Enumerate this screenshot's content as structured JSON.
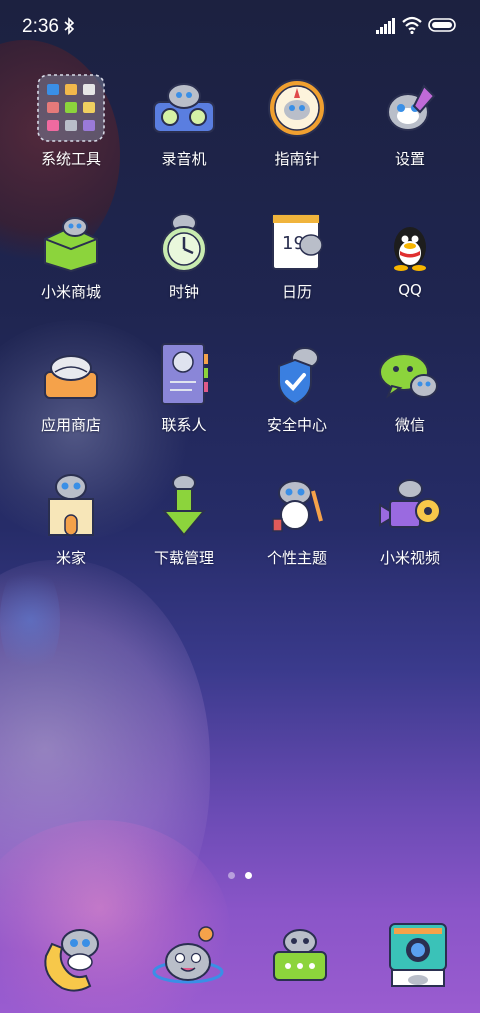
{
  "status_bar": {
    "time": "2:36",
    "icons": [
      "bluetooth-icon",
      "signal-icon",
      "wifi-icon",
      "battery-icon"
    ]
  },
  "apps": [
    {
      "label": "系统工具",
      "icon": "folder-icon"
    },
    {
      "label": "录音机",
      "icon": "recorder-icon"
    },
    {
      "label": "指南针",
      "icon": "compass-icon"
    },
    {
      "label": "设置",
      "icon": "settings-icon"
    },
    {
      "label": "小米商城",
      "icon": "mall-icon"
    },
    {
      "label": "时钟",
      "icon": "clock-icon"
    },
    {
      "label": "日历",
      "icon": "calendar-icon"
    },
    {
      "label": "QQ",
      "icon": "qq-icon"
    },
    {
      "label": "应用商店",
      "icon": "app-store-icon"
    },
    {
      "label": "联系人",
      "icon": "contacts-icon"
    },
    {
      "label": "安全中心",
      "icon": "security-icon"
    },
    {
      "label": "微信",
      "icon": "wechat-icon"
    },
    {
      "label": "米家",
      "icon": "mijia-icon"
    },
    {
      "label": "下载管理",
      "icon": "download-icon"
    },
    {
      "label": "个性主题",
      "icon": "themes-icon"
    },
    {
      "label": "小米视频",
      "icon": "video-icon"
    }
  ],
  "calendar_day": "19",
  "page_indicator": {
    "pages": 2,
    "current": 2
  },
  "dock": [
    {
      "icon": "phone-icon"
    },
    {
      "icon": "browser-icon"
    },
    {
      "icon": "messages-icon"
    },
    {
      "icon": "camera-icon"
    }
  ],
  "colors": {
    "accent_green": "#8cd43c",
    "accent_blue": "#3a8fe6",
    "cat_gray": "#b9bec9"
  }
}
